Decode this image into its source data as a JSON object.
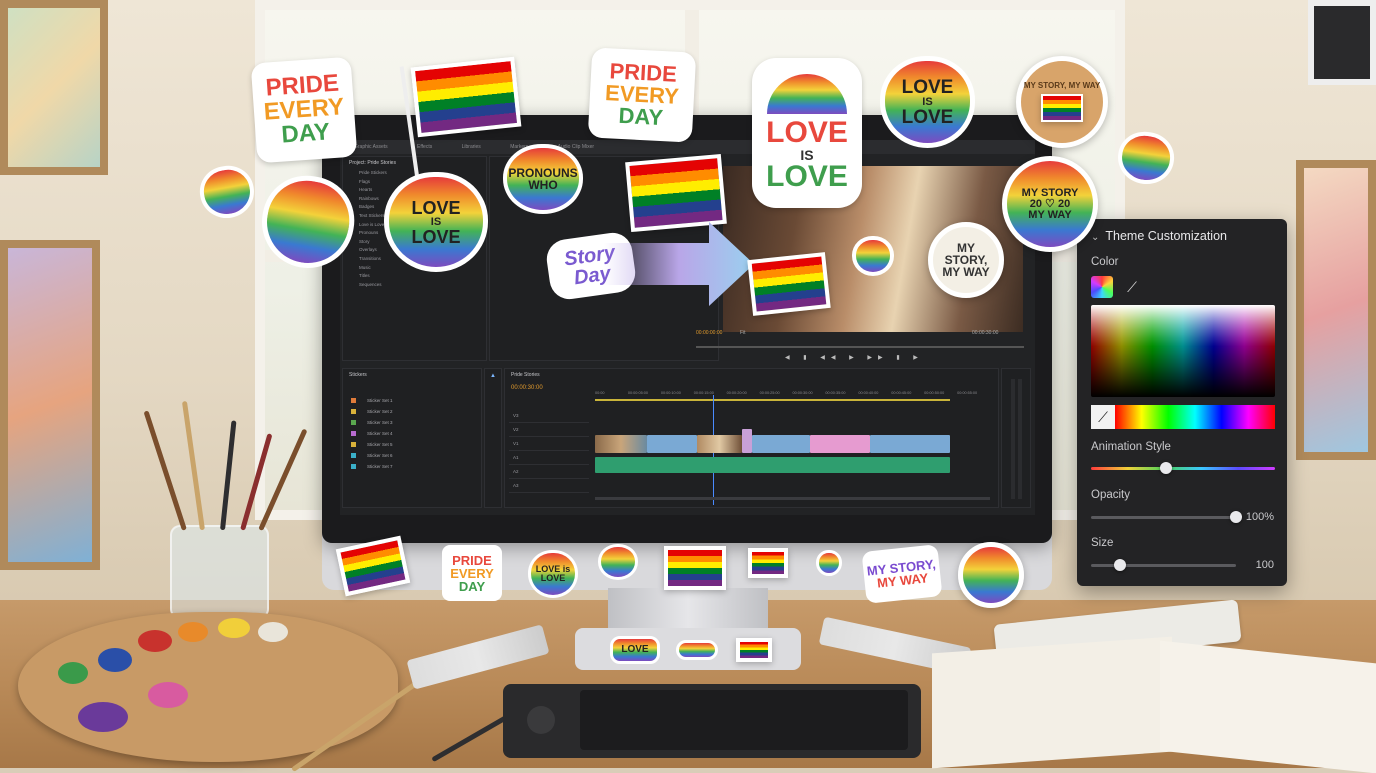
{
  "editor": {
    "menu_tabs": [
      "Graphic Assets",
      "Effects",
      "Libraries",
      "Markers",
      "Audio Clip Mixer"
    ],
    "project_panel_title": "Project: Pride Stories",
    "bin_label": "Stickers",
    "timecode_left": "00:00:00:00",
    "timecode_right": "00:00:30:00",
    "zoom": "Fit",
    "timeline_title": "Pride Stories",
    "timeline_timecode": "00:00:30:00",
    "ruler_marks": [
      "00:00",
      "00:00:05:00",
      "00:00:10:00",
      "00:00:15:00",
      "00:00:20:00",
      "00:00:25:00",
      "00:00:30:00",
      "00:00:35:00",
      "00:00:40:00",
      "00:00:45:00",
      "00:00:50:00",
      "00:00:55:00"
    ],
    "track_labels": [
      "V3",
      "V2",
      "V1",
      "A1",
      "A2",
      "A3"
    ],
    "tree_items": [
      "Pride Stickers",
      "Flags",
      "Hearts",
      "Rainbows",
      "Badges",
      "Text Stickers",
      "Love is Love",
      "Pronouns",
      "Story",
      "Overlays",
      "Transitions",
      "Music",
      "Titles",
      "Sequences"
    ],
    "bin_items": [
      "Sticker Set 1",
      "Sticker Set 2",
      "Sticker Set 3",
      "Sticker Set 4",
      "Sticker Set 5",
      "Sticker Set 6",
      "Sticker Set 7"
    ],
    "bin_colors": [
      "#e07b3a",
      "#d9b23a",
      "#5aa84f",
      "#b86bd0",
      "#d9b23a",
      "#3ab0c9",
      "#3ab0c9"
    ]
  },
  "theme_panel": {
    "title": "Theme Customization",
    "color_label": "Color",
    "animation_label": "Animation Style",
    "animation_level": 0.41,
    "opacity_label": "Opacity",
    "opacity_value": "100%",
    "opacity_level": 1.0,
    "size_label": "Size",
    "size_value": "100",
    "size_level": 0.2
  },
  "stickers": {
    "pride_every_day": [
      "PRIDE",
      "EVERY",
      "DAY"
    ],
    "love_is_love": [
      "LOVE",
      "IS",
      "LOVE"
    ],
    "pronouns": "PRONOUNS WHO",
    "story": "Story Day",
    "my_story_my_way": "MY STORY, MY WAY",
    "badge_2020": [
      "MY STORY",
      "20",
      "20",
      "MY WAY"
    ],
    "badge_ribbon": [
      "MY STORY, MY WAY"
    ],
    "small_love": "LOVE is LOVE",
    "bottom_my_story": [
      "MY STORY,",
      "MY WAY"
    ],
    "stand_love": "LOVE"
  }
}
